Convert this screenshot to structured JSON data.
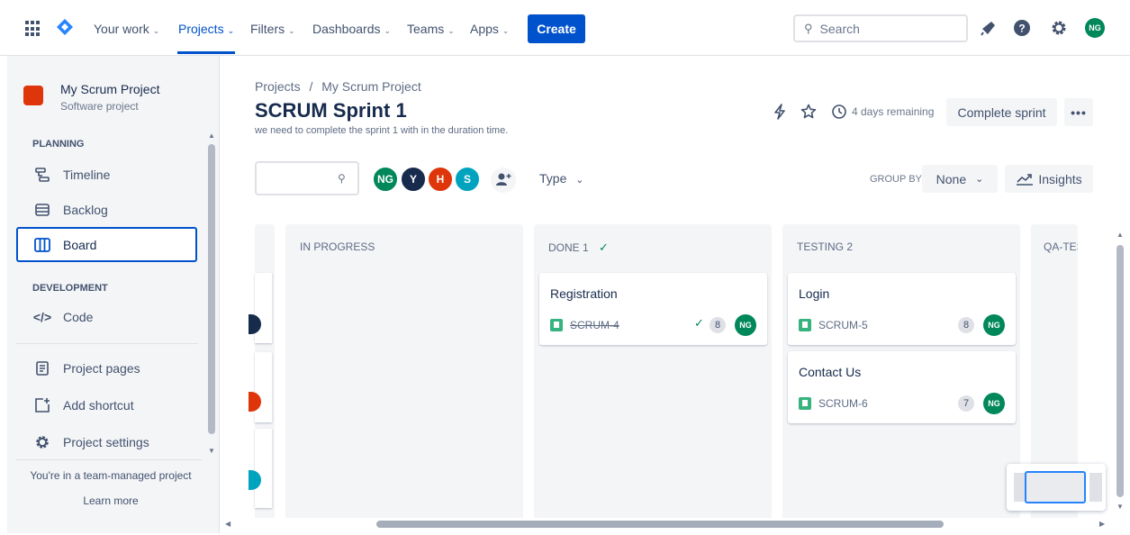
{
  "topnav": {
    "items": [
      {
        "label": "Your work",
        "active": false
      },
      {
        "label": "Projects",
        "active": true
      },
      {
        "label": "Filters",
        "active": false
      },
      {
        "label": "Dashboards",
        "active": false
      },
      {
        "label": "Teams",
        "active": false
      },
      {
        "label": "Apps",
        "active": false
      }
    ],
    "create_label": "Create",
    "search_placeholder": "Search",
    "user_initials": "NG",
    "icons": [
      "app-switcher-icon",
      "jira-logo-icon",
      "notifications-icon",
      "help-icon",
      "settings-icon"
    ]
  },
  "sidebar": {
    "project_name": "My Scrum Project",
    "project_type": "Software project",
    "planning_label": "PLANNING",
    "planning_items": [
      {
        "label": "Timeline",
        "icon": "timeline-icon"
      },
      {
        "label": "Backlog",
        "icon": "backlog-icon"
      },
      {
        "label": "Board",
        "icon": "board-icon",
        "active": true
      }
    ],
    "development_label": "DEVELOPMENT",
    "development_items": [
      {
        "label": "Code",
        "icon": "code-icon"
      }
    ],
    "other_items": [
      {
        "label": "Project pages",
        "icon": "pages-icon"
      },
      {
        "label": "Add shortcut",
        "icon": "add-shortcut-icon"
      },
      {
        "label": "Project settings",
        "icon": "settings-icon"
      }
    ],
    "team_managed_text": "You're in a team-managed project",
    "learn_more": "Learn more"
  },
  "header": {
    "breadcrumb": {
      "projects": "Projects",
      "separator": "/",
      "project": "My Scrum Project"
    },
    "title": "SCRUM Sprint 1",
    "description": "we need to complete the sprint 1 with in the duration time.",
    "days_remaining": "4 days remaining",
    "complete_sprint_label": "Complete sprint",
    "more_label": "•••"
  },
  "filters": {
    "avatars": [
      {
        "initials": "NG",
        "color": "#00875a"
      },
      {
        "initials": "Y",
        "color": "#172b4d"
      },
      {
        "initials": "H",
        "color": "#de350b"
      },
      {
        "initials": "S",
        "color": "#00a3bf"
      }
    ],
    "type_label": "Type",
    "group_by_label": "GROUP BY",
    "group_by_value": "None",
    "insights_label": "Insights"
  },
  "board": {
    "columns": [
      {
        "title": "IN PROGRESS",
        "cards": []
      },
      {
        "title": "DONE 1",
        "done": true,
        "cards": [
          {
            "title": "Registration",
            "key": "SCRUM-4",
            "points": "8",
            "assignee": "NG",
            "done": true
          }
        ]
      },
      {
        "title": "TESTING 2",
        "cards": [
          {
            "title": "Login",
            "key": "SCRUM-5",
            "points": "8",
            "assignee": "NG"
          },
          {
            "title": "Contact Us",
            "key": "SCRUM-6",
            "points": "7",
            "assignee": "NG"
          }
        ]
      },
      {
        "title": "QA-TES",
        "cards": []
      }
    ]
  },
  "colors": {
    "brand": "#0052cc",
    "success": "#00875a",
    "story": "#36b37e"
  }
}
